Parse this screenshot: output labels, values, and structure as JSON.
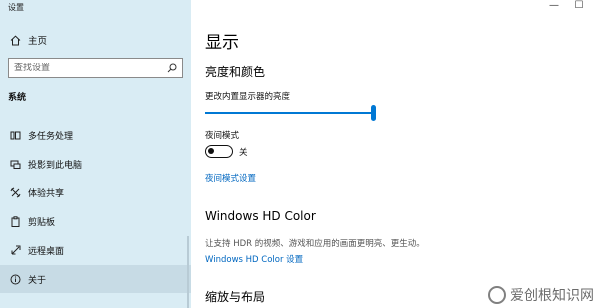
{
  "window": {
    "title": "设置",
    "minimize_glyph": "—",
    "maximize_glyph": "☐"
  },
  "sidebar": {
    "home_label": "主页",
    "search_placeholder": "查找设置",
    "section_label": "系统",
    "items": [
      {
        "label": "多任务处理",
        "icon": "multitasking-icon"
      },
      {
        "label": "投影到此电脑",
        "icon": "project-icon"
      },
      {
        "label": "体验共享",
        "icon": "shared-experiences-icon"
      },
      {
        "label": "剪贴板",
        "icon": "clipboard-icon"
      },
      {
        "label": "远程桌面",
        "icon": "remote-desktop-icon"
      },
      {
        "label": "关于",
        "icon": "info-icon",
        "selected": true
      }
    ]
  },
  "main": {
    "page_title": "显示",
    "brightness_heading": "亮度和颜色",
    "brightness_label": "更改内置显示器的亮度",
    "brightness_value": 100,
    "night_light_label": "夜间模式",
    "night_light_state": "关",
    "night_light_settings_link": "夜间模式设置",
    "hdr_heading": "Windows HD Color",
    "hdr_description": "让支持 HDR 的视频、游戏和应用的画面更明亮、更生动。",
    "hdr_settings_link": "Windows HD Color 设置",
    "scale_heading": "缩放与布局"
  },
  "watermark": {
    "text": "爱创根知识网"
  },
  "colors": {
    "sidebar_bg": "#d9ecf4",
    "accent": "#0078d4",
    "link": "#0067c0"
  }
}
